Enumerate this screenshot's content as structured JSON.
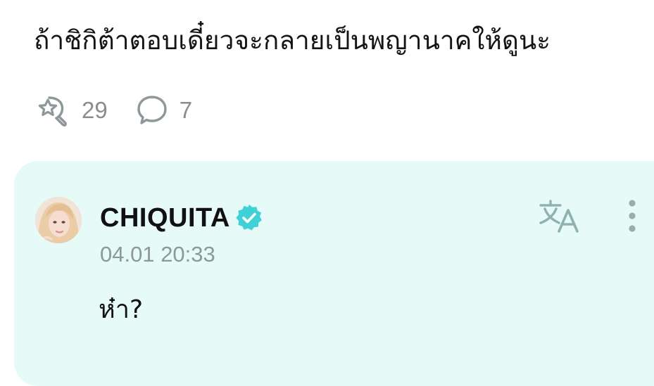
{
  "post": {
    "text": "ถ้าชิกิต้าตอบเดี๋ยวจะกลายเป็นพญานาคให้ดูนะ",
    "like_count": "29",
    "comment_count": "7"
  },
  "comment": {
    "author": "CHIQUITA",
    "verified": true,
    "timestamp": "04.01 20:33",
    "text": "ห๋า?"
  },
  "icons": {
    "like": "star-bubble-icon",
    "comments": "speech-bubble-icon",
    "translate": "translate-icon",
    "more": "more-vertical-icon",
    "verified": "verified-badge-icon"
  },
  "colors": {
    "card_background": "#e6fbf7",
    "verified_badge": "#3fd0d8",
    "icon_gray": "#8e979a",
    "translate_icon": "#8fb1b0",
    "more_dots": "#98aeae"
  }
}
